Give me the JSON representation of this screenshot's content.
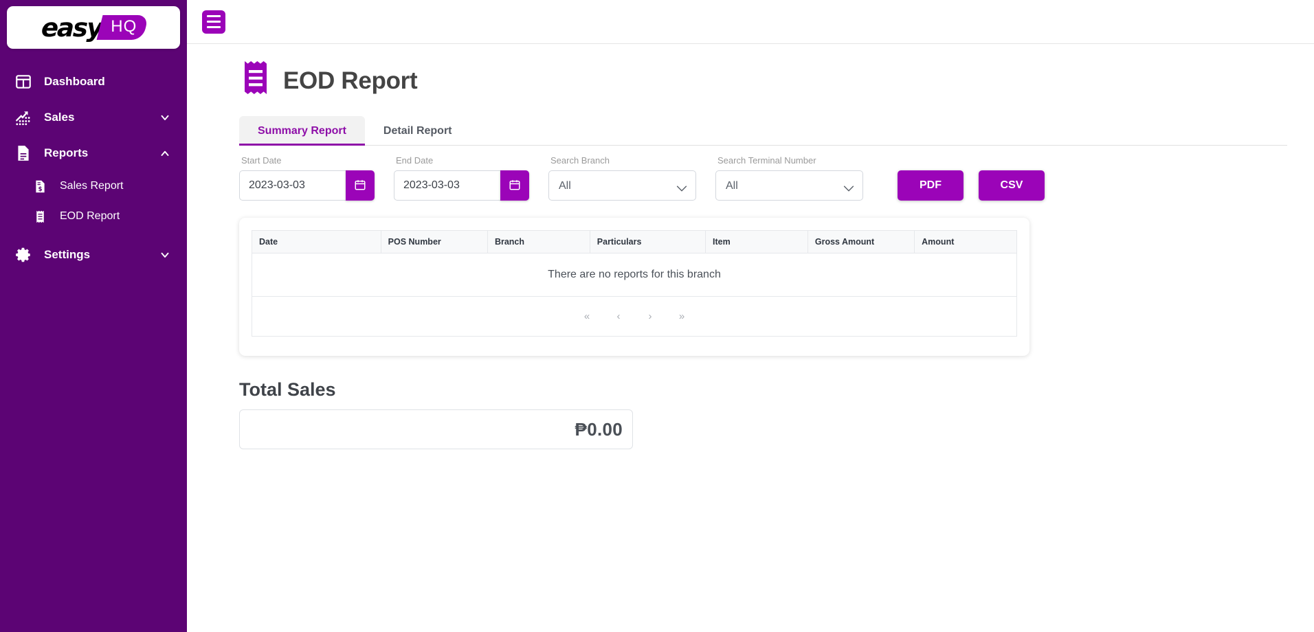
{
  "brand": {
    "logo_primary": "easy",
    "logo_secondary": "HQ",
    "sidebar_color": "#5c0474",
    "accent_color": "#9b04b8",
    "tab_active_color": "#8e0fa8"
  },
  "sidebar": {
    "items": [
      {
        "label": "Dashboard",
        "icon": "dashboard-grid-icon",
        "expandable": false
      },
      {
        "label": "Sales",
        "icon": "sales-trend-icon",
        "expandable": true,
        "state": "collapsed"
      },
      {
        "label": "Reports",
        "icon": "document-icon",
        "expandable": true,
        "state": "expanded"
      },
      {
        "label": "Settings",
        "icon": "gear-icon",
        "expandable": true,
        "state": "collapsed"
      }
    ],
    "reports_children": [
      {
        "label": "Sales Report",
        "icon": "document-dollar-icon"
      },
      {
        "label": "EOD Report",
        "icon": "receipt-icon"
      }
    ]
  },
  "topbar": {
    "menu_icon": "hamburger-icon"
  },
  "page": {
    "title": "EOD Report",
    "title_icon": "receipt-icon"
  },
  "tabs": [
    {
      "label": "Summary Report",
      "active": true
    },
    {
      "label": "Detail Report",
      "active": false
    }
  ],
  "filters": {
    "start_date": {
      "label": "Start Date",
      "value": "2023-03-03",
      "placeholder": "YYYY-MM-DD",
      "button_icon": "calendar-icon"
    },
    "end_date": {
      "label": "End Date",
      "value": "2023-03-03",
      "placeholder": "YYYY-MM-DD",
      "button_icon": "calendar-icon"
    },
    "branch": {
      "label": "Search Branch",
      "value": "All",
      "options": [
        "All"
      ]
    },
    "terminal": {
      "label": "Search Terminal Number",
      "value": "All",
      "options": [
        "All"
      ]
    }
  },
  "actions": {
    "pdf_label": "PDF",
    "csv_label": "CSV"
  },
  "table": {
    "columns": [
      "Date",
      "POS Number",
      "Branch",
      "Particulars",
      "Item",
      "Gross Amount",
      "Amount"
    ],
    "rows": [],
    "empty_message": "There are no reports for this branch"
  },
  "pagination": {
    "first_label": "«",
    "prev_label": "‹",
    "next_label": "›",
    "last_label": "»"
  },
  "total_sales": {
    "title": "Total Sales",
    "value": "₱0.00"
  }
}
